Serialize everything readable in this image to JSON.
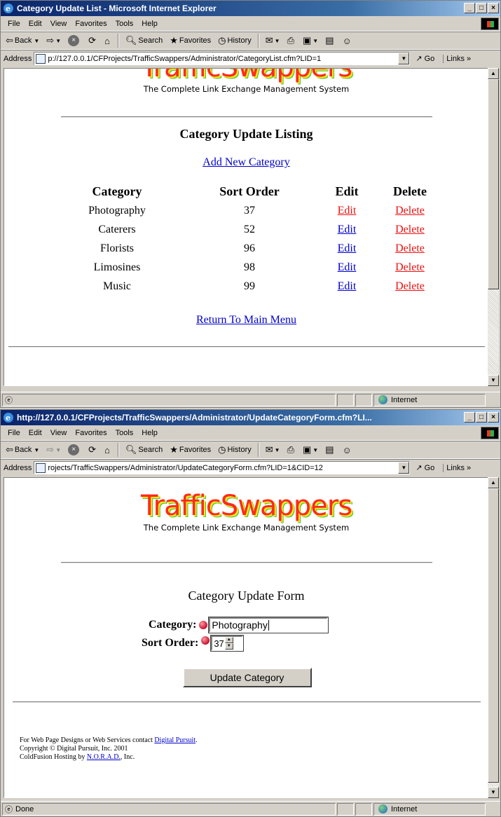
{
  "window1": {
    "title": "Category Update List - Microsoft Internet Explorer",
    "menu": [
      "File",
      "Edit",
      "View",
      "Favorites",
      "Tools",
      "Help"
    ],
    "toolbar": {
      "back": "Back",
      "search": "Search",
      "favorites": "Favorites",
      "history": "History"
    },
    "address_label": "Address",
    "address_value": "p://127.0.0.1/CFProjects/TrafficSwappers/Administrator/CategoryList.cfm?LID=1",
    "go_label": "Go",
    "links_label": "Links »",
    "page": {
      "logo": "TrafficSwappers",
      "tagline": "The Complete Link Exchange Management System",
      "heading": "Category Update Listing",
      "add_link": "Add New Category",
      "columns": [
        "Category",
        "Sort Order",
        "Edit",
        "Delete"
      ],
      "rows": [
        {
          "category": "Photography",
          "sort": "37",
          "edit": "Edit",
          "delete": "Delete",
          "edit_visited": true
        },
        {
          "category": "Caterers",
          "sort": "52",
          "edit": "Edit",
          "delete": "Delete",
          "edit_visited": false
        },
        {
          "category": "Florists",
          "sort": "96",
          "edit": "Edit",
          "delete": "Delete",
          "edit_visited": false
        },
        {
          "category": "Limosines",
          "sort": "98",
          "edit": "Edit",
          "delete": "Delete",
          "edit_visited": false
        },
        {
          "category": "Music",
          "sort": "99",
          "edit": "Edit",
          "delete": "Delete",
          "edit_visited": false
        }
      ],
      "return_link": "Return To Main Menu"
    },
    "status": {
      "text": "",
      "zone": "Internet"
    }
  },
  "window2": {
    "title": "http://127.0.0.1/CFProjects/TrafficSwappers/Administrator/UpdateCategoryForm.cfm?LI...",
    "menu": [
      "File",
      "Edit",
      "View",
      "Favorites",
      "Tools",
      "Help"
    ],
    "toolbar": {
      "back": "Back",
      "search": "Search",
      "favorites": "Favorites",
      "history": "History"
    },
    "address_label": "Address",
    "address_value": "rojects/TrafficSwappers/Administrator/UpdateCategoryForm.cfm?LID=1&CID=12",
    "go_label": "Go",
    "links_label": "Links »",
    "page": {
      "logo": "TrafficSwappers",
      "tagline": "The Complete Link Exchange Management System",
      "heading": "Category Update Form",
      "category_label": "Category:",
      "category_value": "Photography",
      "sort_label": "Sort Order:",
      "sort_value": "37",
      "submit": "Update Category",
      "footer_line1_prefix": "For Web Page Designs or Web Services contact",
      "footer_line1_link": "Digital Pursuit",
      "footer_line2": "Copyright © Digital Pursuit, Inc. 2001",
      "footer_line3_prefix": "ColdFusion Hosting by",
      "footer_line3_link": "N.O.R.A.D.",
      "footer_line3_suffix": ", Inc."
    },
    "status": {
      "text": "Done",
      "zone": "Internet"
    }
  },
  "colors": {
    "title_start": "#0a246a",
    "title_end": "#a6caf0",
    "link": "#0000cc",
    "visited": "#ee1111",
    "logo_red": "#ff2a1a"
  }
}
